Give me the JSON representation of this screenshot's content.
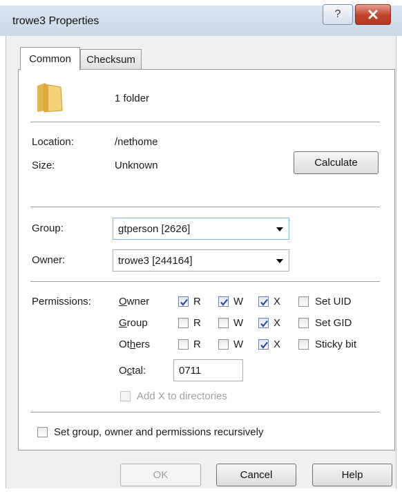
{
  "window": {
    "title": "trowe3 Properties",
    "help_glyph": "?",
    "close_glyph": "✕"
  },
  "tabs": [
    {
      "label": "Common",
      "selected": true
    },
    {
      "label": "Checksum",
      "selected": false
    }
  ],
  "summary": {
    "icon": "folder-icon",
    "text": "1 folder"
  },
  "info": {
    "location_label": "Location:",
    "location_value": "/nethome",
    "size_label": "Size:",
    "size_value": "Unknown",
    "calculate_label": "Calculate"
  },
  "group": {
    "label": "Group:",
    "value": "gtperson [2626]"
  },
  "owner": {
    "label": "Owner:",
    "value": "trowe3 [244164]"
  },
  "permissions": {
    "label": "Permissions:",
    "rows": [
      {
        "name_pre": "",
        "name_u": "O",
        "name_post": "wner",
        "r": true,
        "w": true,
        "x": true,
        "special": "Set UID",
        "special_checked": false
      },
      {
        "name_pre": "",
        "name_u": "G",
        "name_post": "roup",
        "r": false,
        "w": false,
        "x": true,
        "special": "Set GID",
        "special_checked": false
      },
      {
        "name_pre": "Ot",
        "name_u": "h",
        "name_post": "ers",
        "r": false,
        "w": false,
        "x": true,
        "special": "Sticky bit",
        "special_checked": false
      }
    ],
    "r_label": "R",
    "w_label": "W",
    "x_label": "X",
    "octal_pre": "O",
    "octal_u": "c",
    "octal_post": "tal:",
    "octal_value": "0711",
    "add_x_label": "Add X to directories",
    "add_x_checked": false
  },
  "recursive": {
    "label": "Set group, owner and permissions recursively",
    "checked": false
  },
  "buttons": {
    "ok": "OK",
    "cancel": "Cancel",
    "help": "Help"
  }
}
